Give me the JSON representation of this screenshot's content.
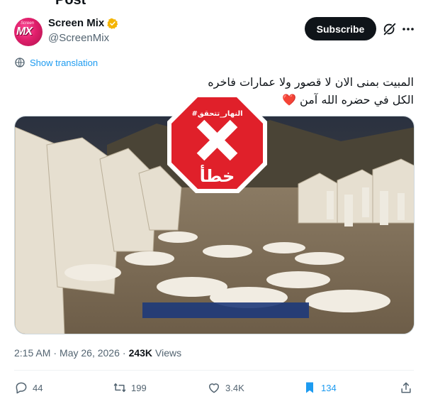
{
  "header": {
    "title": "Post"
  },
  "author": {
    "display_name": "Screen Mix",
    "handle": "@ScreenMix",
    "avatar_text": "MX",
    "avatar_small_text": "Screen",
    "verified_color": "#f4b400"
  },
  "buttons": {
    "subscribe_label": "Subscribe"
  },
  "translate": {
    "label": "Show translation"
  },
  "tweet": {
    "line1": "المبيت بمنى الان  لا قصور ولا عمارات فاخره",
    "line2": "الكل في حضره الله آمن",
    "heart": "❤️"
  },
  "media": {
    "stamp_top_text": "#النهار_تتحقق",
    "stamp_bottom_text": "خطأ",
    "stamp_color": "#e0202a"
  },
  "meta": {
    "time": "2:15 AM",
    "separator": "·",
    "date": "May 26, 2026",
    "separator2": "·",
    "views_count": "243K",
    "views_label": "Views"
  },
  "actions": {
    "replies": "44",
    "reposts": "199",
    "likes": "3.4K",
    "bookmarks": "134",
    "bookmark_color": "#1d9bf0"
  },
  "colors": {
    "accent": "#1d9bf0",
    "text_primary": "#0f1419",
    "text_secondary": "#536471"
  }
}
